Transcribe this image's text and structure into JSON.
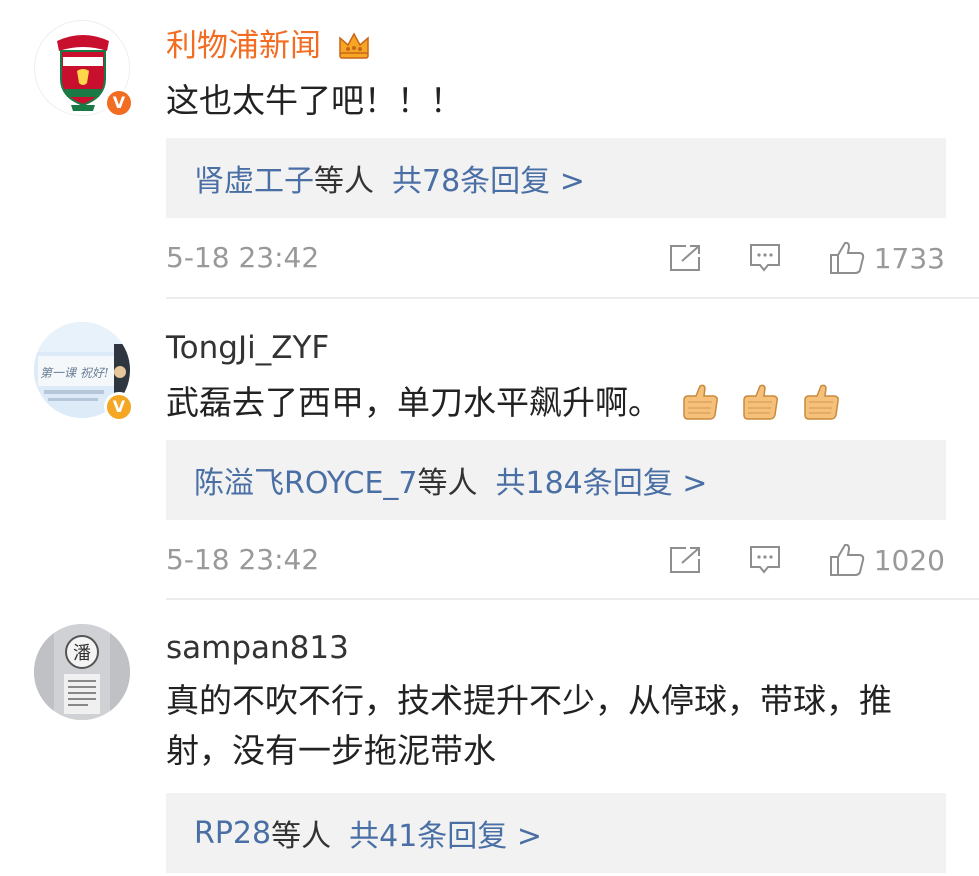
{
  "comments": [
    {
      "username": "利物浦新闻",
      "content": "这也太牛了吧！！！",
      "reply_users": "肾虚工子",
      "reply_suffix": "等人",
      "reply_count": "共78条回复 >",
      "time": "5-18 23:42",
      "likes": "1733",
      "avatar_color": "#c8102e",
      "badge_color": "#f26d22"
    },
    {
      "username": "TongJi_ZYF",
      "content": "武磊去了西甲，单刀水平飙升啊。",
      "reply_users": "陈溢飞ROYCE_7",
      "reply_suffix": "等人",
      "reply_count": "共184条回复 >",
      "time": "5-18 23:42",
      "likes": "1020",
      "badge_color": "#f5a623"
    },
    {
      "username": "sampan813",
      "content": "真的不吹不行，技术提升不少，从停球，带球，推射，没有一步拖泥带水",
      "reply_users": "RP28",
      "reply_suffix": "等人",
      "reply_count": "共41条回复 >"
    }
  ],
  "icons": {
    "crown": "crown-icon",
    "share": "share-icon",
    "comment": "comment-icon",
    "like": "thumbs-up-icon",
    "emoji": "thumbs-up-emoji",
    "verified": "verified-v-badge"
  }
}
